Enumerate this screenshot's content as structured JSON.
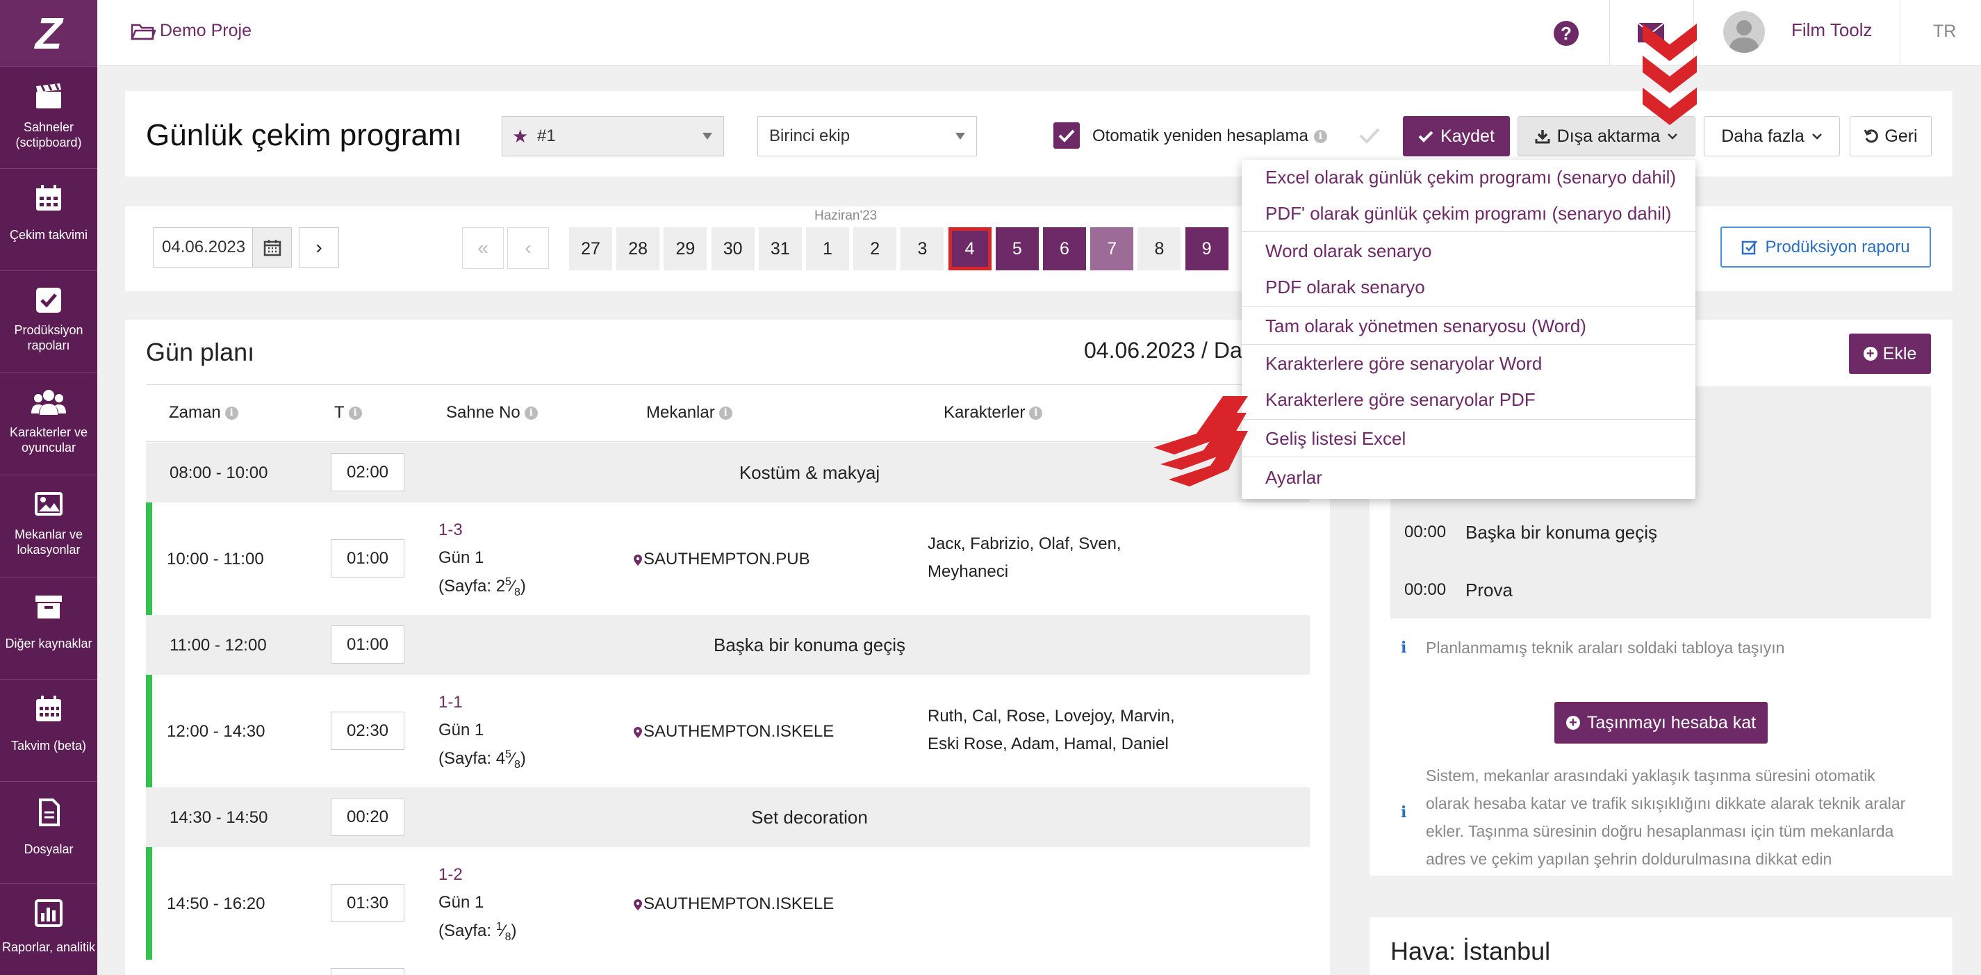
{
  "topbar": {
    "project_name": "Demo Proje",
    "user_name": "Film Toolz",
    "language": "TR"
  },
  "sidebar": {
    "items": [
      {
        "label": "Sahneler (sctipboard)",
        "icon": "clapperboard-icon"
      },
      {
        "label": "Çekim takvimi",
        "icon": "calendar-icon"
      },
      {
        "label": "Prodüksiyon rapoları",
        "icon": "checkbox-icon"
      },
      {
        "label": "Karakterler ve oyuncular",
        "icon": "users-icon"
      },
      {
        "label": "Mekanlar ve lokasyonlar",
        "icon": "image-icon"
      },
      {
        "label": "Diğer kaynaklar",
        "icon": "archive-icon"
      },
      {
        "label": "Takvim (beta)",
        "icon": "calendar-grid-icon"
      },
      {
        "label": "Dosyalar",
        "icon": "file-icon"
      },
      {
        "label": "Raporlar, analitik",
        "icon": "bar-chart-icon"
      }
    ]
  },
  "header": {
    "title": "Günlük çekim programı",
    "schedule_select": "#1",
    "unit_select": "Birinci ekip",
    "auto_recalc_label": "Otomatik yeniden hesaplama",
    "auto_recalc_checked": true,
    "save_label": "Kaydet",
    "export_label": "Dışa aktarma",
    "more_label": "Daha fazla",
    "back_label": "Geri"
  },
  "datebar": {
    "date_value": "04.06.2023",
    "month_label": "Haziran'23",
    "days": [
      {
        "d": "27",
        "state": "plain"
      },
      {
        "d": "28",
        "state": "plain"
      },
      {
        "d": "29",
        "state": "plain"
      },
      {
        "d": "30",
        "state": "plain"
      },
      {
        "d": "31",
        "state": "plain"
      },
      {
        "d": "1",
        "state": "plain"
      },
      {
        "d": "2",
        "state": "plain"
      },
      {
        "d": "3",
        "state": "plain"
      },
      {
        "d": "4",
        "state": "selected"
      },
      {
        "d": "5",
        "state": "shoot"
      },
      {
        "d": "6",
        "state": "shoot"
      },
      {
        "d": "7",
        "state": "light"
      },
      {
        "d": "8",
        "state": "plain"
      },
      {
        "d": "9",
        "state": "shoot"
      }
    ],
    "report_button": "Prodüksiyon raporu"
  },
  "dayplan": {
    "title": "Gün planı",
    "date_title": "04.06.2023 / Da",
    "columns": [
      "Zaman",
      "T",
      "Sahne No",
      "Mekanlar",
      "Karakterler"
    ],
    "rows": [
      {
        "type": "break",
        "time": "08:00 - 10:00",
        "dur": "02:00",
        "label": "Kostüm & makyaj"
      },
      {
        "type": "scene",
        "time": "10:00 - 11:00",
        "dur": "01:00",
        "scene": "1-3",
        "day": "Gün 1",
        "page_prefix": "(Sayfa: 2",
        "page_frac_num": "5",
        "page_frac_den": "8",
        "location": "SAUTHEMPTON.PUB",
        "chars1": "Jacк, Fabrizio, Olaf, Sven,",
        "chars2": "Meyhaneci"
      },
      {
        "type": "break",
        "time": "11:00 - 12:00",
        "dur": "01:00",
        "label": "Başka bir konuma geçiş"
      },
      {
        "type": "scene",
        "time": "12:00 - 14:30",
        "dur": "02:30",
        "scene": "1-1",
        "day": "Gün 1",
        "page_prefix": "(Sayfa: 4",
        "page_frac_num": "5",
        "page_frac_den": "8",
        "location": "SAUTHEMPTON.ISKELE",
        "chars1": "Ruth, Cal, Rose, Lovejoy, Marvin,",
        "chars2": "Eski Rose, Adam, Hamal, Daniel"
      },
      {
        "type": "break",
        "time": "14:30 - 14:50",
        "dur": "00:20",
        "label": "Set decoration"
      },
      {
        "type": "scene",
        "time": "14:50 - 16:20",
        "dur": "01:30",
        "scene": "1-2",
        "day": "Gün 1",
        "page_prefix": "(Sayfa: ",
        "page_frac_num": "1",
        "page_frac_den": "8",
        "location": "SAUTHEMPTON.ISKELE",
        "chars1": "",
        "chars2": ""
      }
    ]
  },
  "right_panel": {
    "add_button": "Ekle",
    "breaks": [
      {
        "dur": "00:00",
        "label": "Başka bir konuma geçiş"
      },
      {
        "dur": "00:00",
        "label": "Prova"
      }
    ],
    "hint": "Planlanmamış teknik araları soldaki tabloya taşıyın",
    "travel_button": "Taşınmayı hesaba kat",
    "travel_info_lines": [
      "Sistem, mekanlar arasındaki yaklaşık taşınma süresini otomatik",
      "olarak hesaba katar ve trafik sıkışıklığını dikkate alarak teknik aralar",
      "ekler. Taşınma süresinin doğru hesaplanması için tüm mekanlarda",
      "adres ve çekim yapılan şehrin doldurulmasına dikkat edin"
    ],
    "weather_title": "Hava: İstanbul"
  },
  "export_menu": {
    "items": [
      "Excel olarak günlük çekim programı (senaryo dahil)",
      "PDF' olarak günlük çekim programı (senaryo dahil)",
      "Word olarak senaryo",
      "PDF olarak senaryo",
      "Tam olarak yönetmen senaryosu (Word)",
      "Karakterlere göre senaryolar Word",
      "Karakterlere göre senaryolar PDF",
      "Geliş listesi Excel",
      "Ayarlar"
    ]
  },
  "colors": {
    "brand": "#6d2a67",
    "sidebar": "#5c1d55",
    "green": "#33c24d",
    "annotation_red": "#d9242a"
  }
}
